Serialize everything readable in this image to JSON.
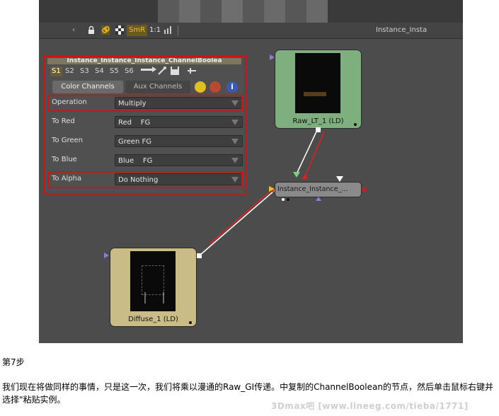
{
  "toolbar": {
    "smr_label": "SmR",
    "scale_label": "1:1",
    "right_label": "Instance_Insta"
  },
  "inspector": {
    "title": "Instance_Instance_Instance_ChannelBoolea",
    "scene_tabs": [
      "S1",
      "S2",
      "S3",
      "S4",
      "S5",
      "S6"
    ],
    "tabs": [
      "Color Channels",
      "Aux Channels"
    ],
    "params": [
      {
        "label": "Operation",
        "value": "Multiply"
      },
      {
        "label": "To Red",
        "value": "Red    FG"
      },
      {
        "label": "To Green",
        "value": "Green FG"
      },
      {
        "label": "To Blue",
        "value": "Blue    FG"
      },
      {
        "label": "To Alpha",
        "value": "Do Nothing"
      }
    ]
  },
  "nodes": {
    "raw": {
      "label": "Raw_LT_1  (LD)",
      "color": "#7fae7f"
    },
    "instance": {
      "label": "Instance_Instance_..."
    },
    "diffuse": {
      "label": "Diffuse_1  (LD)",
      "color": "#c9bc86"
    }
  },
  "caption": {
    "step": "第7步",
    "text": "我们现在将做同样的事情，只是这一次，我们将乘以漫通的Raw_GI传递。中复制的ChannelBoolean的节点，然后单击鼠标右键并选择\"粘贴实例。"
  },
  "watermark": "3Dmax吧  [www.lineeg.com/tieba/1771]",
  "colors": {
    "highlight": "#d51212",
    "link_red": "#e02020",
    "link_white": "#ffffff"
  }
}
